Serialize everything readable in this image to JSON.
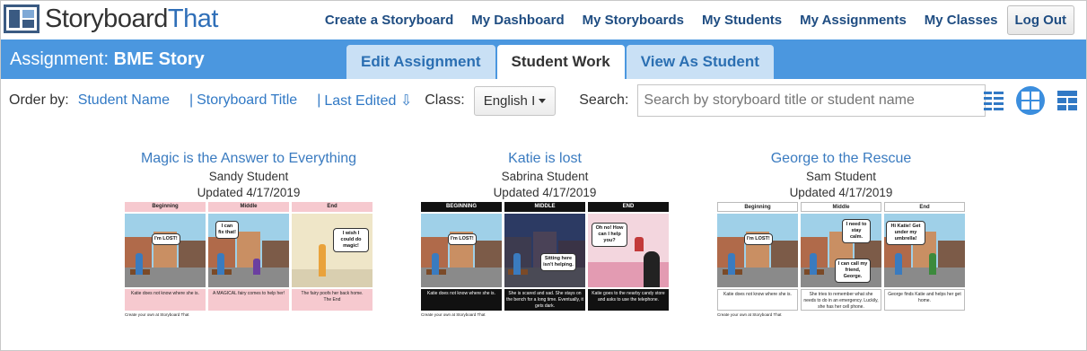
{
  "header": {
    "logo_primary": "Storyboard",
    "logo_accent": "That",
    "nav": [
      "Create a Storyboard",
      "My Dashboard",
      "My Storyboards",
      "My Students",
      "My Assignments",
      "My Classes"
    ],
    "logout_label": "Log Out"
  },
  "band": {
    "assignment_label": "Assignment:",
    "assignment_name": "BME Story",
    "tabs": [
      "Edit Assignment",
      "Student Work",
      "View As Student"
    ],
    "active_tab": "Student Work"
  },
  "filters": {
    "order_by_label": "Order by:",
    "order_options": [
      "Student Name",
      "Storyboard Title",
      "Last Edited ⇩"
    ],
    "class_label": "Class:",
    "class_value": "English I",
    "search_label": "Search:",
    "search_placeholder": "Search by storyboard title or student name",
    "view_icons": [
      "list-view-icon",
      "grid-view-icon",
      "tile-view-icon"
    ]
  },
  "cards": [
    {
      "title": "Magic is the Answer to Everything",
      "student": "Sandy Student",
      "updated": "Updated 4/17/2019",
      "headers": [
        "Beginning",
        "Middle",
        "End"
      ],
      "header_bg": "#f6c9cf",
      "header_fg": "#222",
      "caption_bg": "#f6c9cf",
      "captions": [
        "Katie does not know where she is.",
        "A MAGICAL fairy comes to help her!",
        "The fairy poofs her back home.\nThe End"
      ],
      "bubbles": [
        "I'm LOST!",
        "I can fix that!",
        "I wish I could do magic!"
      ],
      "footer": "Create your own at Storyboard That"
    },
    {
      "title": "Katie is lost",
      "student": "Sabrina Student",
      "updated": "Updated 4/17/2019",
      "headers": [
        "BEGINNING",
        "MIDDLE",
        "END"
      ],
      "header_bg": "#111111",
      "header_fg": "#ffffff",
      "caption_bg": "#111111",
      "captions": [
        "Katie does not know where she is.",
        "She is scared and sad. She stays on the bench for a long time. Eventually, it gets dark.",
        "Katie goes to the nearby candy store and asks to use the telephone."
      ],
      "bubbles": [
        "I'm LOST!",
        "Sitting here isn't helping.",
        "Oh no! How can I help you?"
      ],
      "footer": "Create your own at Storyboard That"
    },
    {
      "title": "George to the Rescue",
      "student": "Sam Student",
      "updated": "Updated 4/17/2019",
      "headers": [
        "Beginning",
        "Middle",
        "End"
      ],
      "header_bg": "#ffffff",
      "header_fg": "#222",
      "caption_bg": "#ffffff",
      "captions": [
        "Katie does not know where she is.",
        "She tries to remember what she needs to do in an emergency. Luckily, she has her cell phone.",
        "George finds Katie and helps her get home."
      ],
      "bubbles": [
        "I'm LOST!",
        "I need to stay calm.",
        "I can call my friend, George.",
        "Hi Katie! Get under my umbrella!"
      ],
      "footer": "Create your own at Storyboard That"
    }
  ],
  "colors": {
    "band": "#4b97df",
    "link": "#3179c5",
    "nav": "#1f4d82"
  }
}
